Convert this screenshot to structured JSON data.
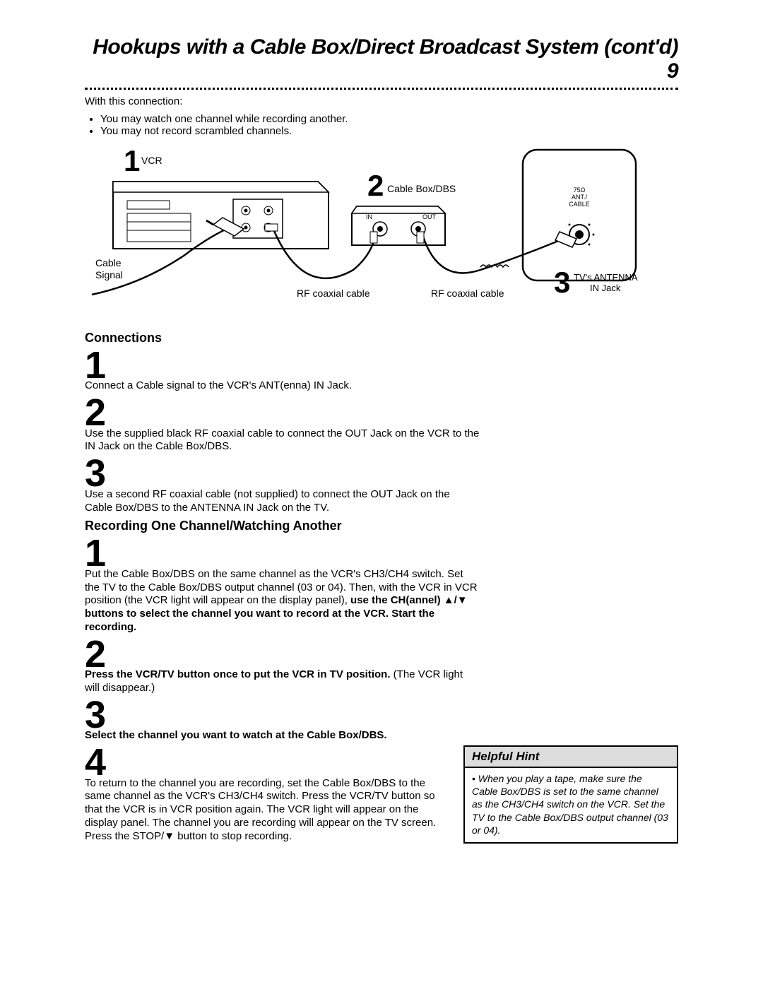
{
  "title": "Hookups with a Cable Box/Direct Broadcast System (cont'd)  9",
  "intro": "With this connection:",
  "bullets": [
    "You may watch one channel while recording another.",
    "You may not record scrambled channels."
  ],
  "diagram": {
    "n1": "1",
    "vcr": "VCR",
    "n2": "2",
    "cablebox": "Cable Box/DBS",
    "n3": "3",
    "tvant_a": "TV's ANTENNA",
    "tvant_b": "IN Jack",
    "cable_signal_a": "Cable",
    "cable_signal_b": "Signal",
    "rf1": "RF coaxial cable",
    "rf2": "RF coaxial cable",
    "in": "IN",
    "out": "OUT",
    "ant_small_a": "75Ω",
    "ant_small_b": "ANT./",
    "ant_small_c": "CABLE"
  },
  "connections_head": "Connections",
  "conn": [
    {
      "n": "1",
      "text": "Connect a Cable signal to the VCR's ANT(enna) IN Jack."
    },
    {
      "n": "2",
      "text": "Use the supplied black RF coaxial cable to connect the OUT Jack on the VCR to the IN Jack on the Cable Box/DBS."
    },
    {
      "n": "3",
      "text": "Use a second RF coaxial cable (not supplied) to connect the OUT Jack on the Cable Box/DBS to the ANTENNA IN Jack on the TV."
    }
  ],
  "rec_head": "Recording One Channel/Watching Another",
  "rec1": {
    "n": "1",
    "text_a": "Put the Cable Box/DBS on the same channel as the VCR's CH3/CH4 switch. Set the TV to the Cable Box/DBS output channel (03 or 04). Then, with the VCR in VCR position (the VCR light will appear on the display panel), ",
    "bold": "use the CH(annel) ▲/▼ buttons to select the channel you want to record at the VCR. Start the recording."
  },
  "rec2": {
    "n": "2",
    "bold": "Press the VCR/TV button once to put the VCR in TV position.",
    "text_b": " (The VCR light will disappear.)"
  },
  "rec3": {
    "n": "3",
    "bold": "Select the channel you want to watch at the Cable Box/DBS."
  },
  "rec4": {
    "n": "4",
    "text": "To return to the channel you are recording, set the Cable Box/DBS to the same channel as the VCR's CH3/CH4 switch. Press the VCR/TV button so that the VCR is in VCR position again. The VCR light will appear on the display panel. The channel you are recording will appear on the TV screen. Press the STOP/▼ button to stop recording."
  },
  "hint_head": "Helpful Hint",
  "hint_body": "When you play a tape, make sure the Cable Box/DBS is set to the same channel as the CH3/CH4 switch on the VCR. Set the TV to the Cable Box/DBS output channel (03 or 04)."
}
